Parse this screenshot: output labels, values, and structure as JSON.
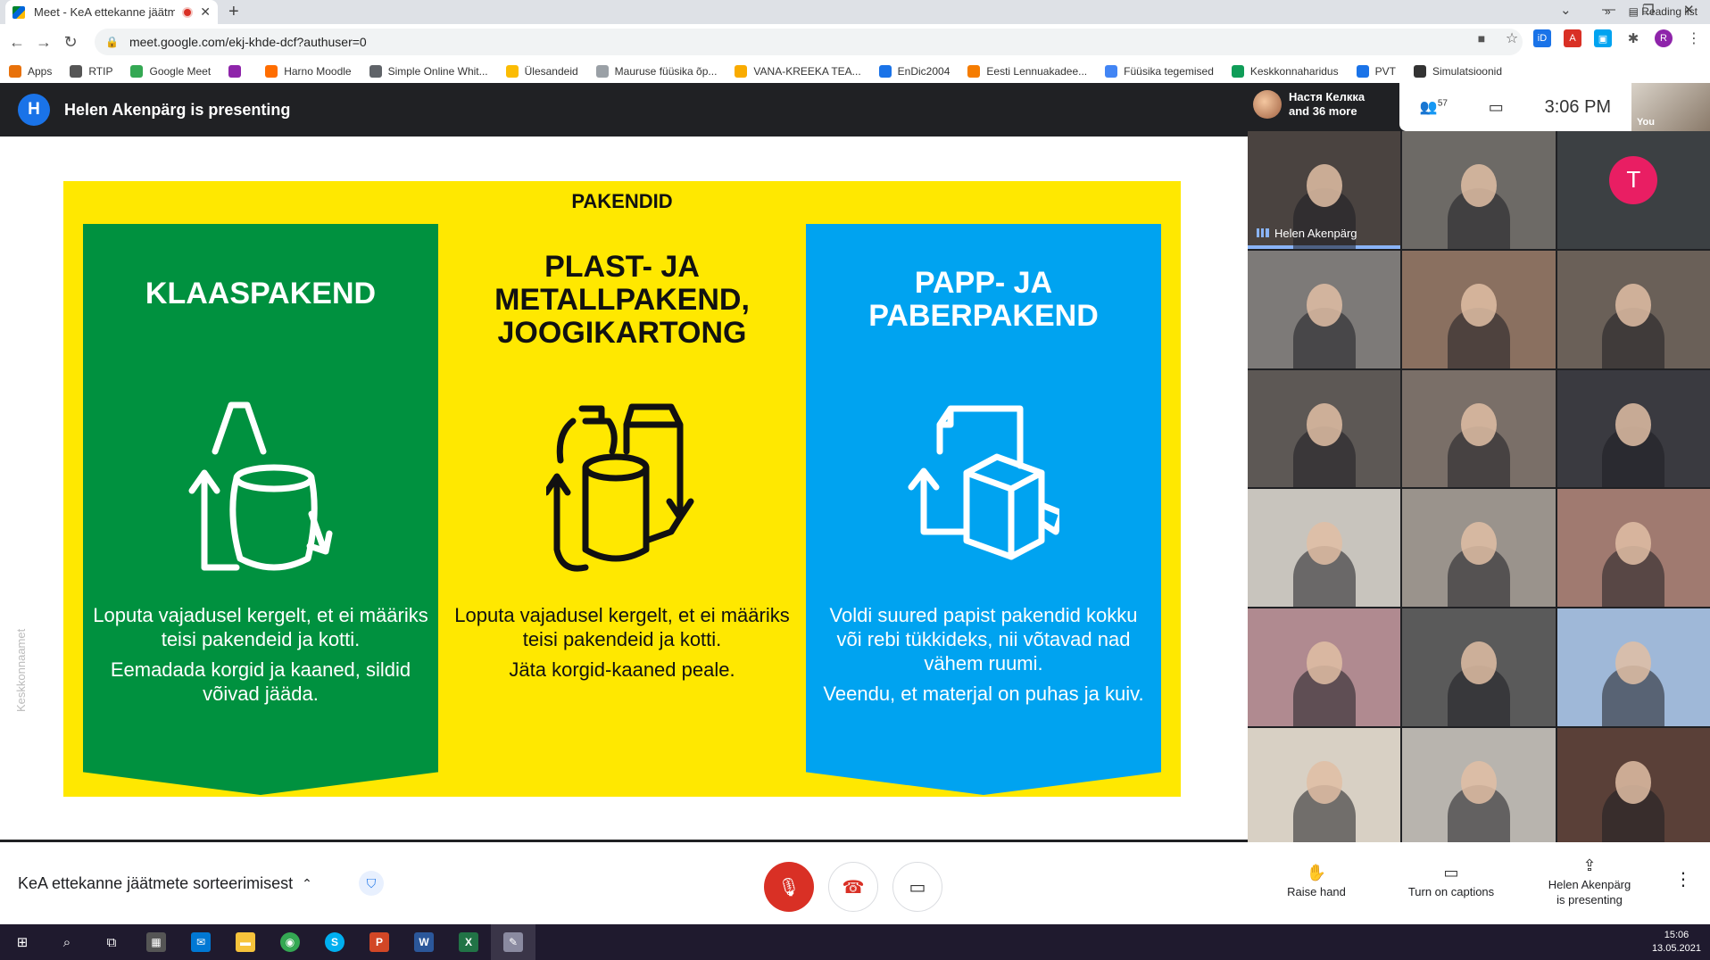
{
  "browser": {
    "tab_title": "Meet - KeA ettekanne jäätme",
    "url": "meet.google.com/ekj-khde-dcf?authuser=0",
    "profile_initial": "R",
    "bookmarks": [
      "Apps",
      "RTIP",
      "Google Meet",
      "",
      "Harno Moodle",
      "Simple Online Whit...",
      "Ülesandeid",
      "Mauruse füüsika õp...",
      "VANA-KREEKA TEA...",
      "EnDic2004",
      "Eesti Lennuakadee...",
      "Füüsika tegemised",
      "Keskkonnaharidus",
      "PVT",
      "Simulatsioonid"
    ],
    "bookmark_colors": [
      "#e8710a",
      "#555555",
      "#34a853",
      "#8e24aa",
      "#ff6d00",
      "#5f6368",
      "#fbbc04",
      "#9aa0a6",
      "#f9ab00",
      "#1a73e8",
      "#f57c00",
      "#4285f4",
      "#0f9d58",
      "#1a73e8",
      "#333333"
    ],
    "more": "»",
    "reading_list": "Reading list"
  },
  "meet": {
    "presenter_initial": "H",
    "presenting_text": "Helen Akenpärg is presenting",
    "participants_summary_line1": "Настя Келкка",
    "participants_summary_line2": "and 36 more",
    "participant_count": "57",
    "clock": "3:06 PM",
    "self_label": "You",
    "active_speaker": "Helen Akenpärg",
    "tile_T_initial": "T",
    "meeting_name": "KeA ettekanne jäätmete sorteerimisest",
    "raise_hand": "Raise hand",
    "captions": "Turn on captions",
    "presenting_line1": "Helen Akenpärg",
    "presenting_line2": "is presenting"
  },
  "slide": {
    "title": "PAKENDID",
    "watermark": "Keskkonnaamet",
    "columns": [
      {
        "heading": [
          "KLAASPAKEND"
        ],
        "text1": "Loputa vajadusel kergelt, et ei määriks teisi pakendeid ja kotti.",
        "text2": "Eemadada korgid ja kaaned, sildid võivad jääda.",
        "color": "#00913f",
        "text_color": "#ffffff"
      },
      {
        "heading": [
          "PLAST- JA",
          "METALLPAKEND,",
          "JOOGIKARTONG"
        ],
        "text1": "Loputa vajadusel kergelt, et ei määriks teisi pakendeid ja kotti.",
        "text2": "Jäta korgid-kaaned peale.",
        "color": "#ffe800",
        "text_color": "#111111"
      },
      {
        "heading": [
          "PAPP- JA",
          "PABERPAKEND"
        ],
        "text1": "Voldi suured papist pakendid kokku või rebi tükkideks, nii võtavad nad vähem ruumi.",
        "text2": "Veendu, et materjal on puhas ja kuiv.",
        "color": "#00a3f0",
        "text_color": "#ffffff"
      }
    ]
  },
  "tile_colors": [
    "#4a4340",
    "#6d6a66",
    "#3c4043",
    "#7d7a78",
    "#8a7060",
    "#6a6058",
    "#5d5855",
    "#7a6f68",
    "#3a3a40",
    "#c8c4bd",
    "#9a938c",
    "#a07a70",
    "#b08a90",
    "#5a5a5a",
    "#9fb8d8",
    "#d8d0c4",
    "#b8b4ae",
    "#5a4038"
  ],
  "taskbar": {
    "time": "15:06",
    "date": "13.05.2021"
  }
}
